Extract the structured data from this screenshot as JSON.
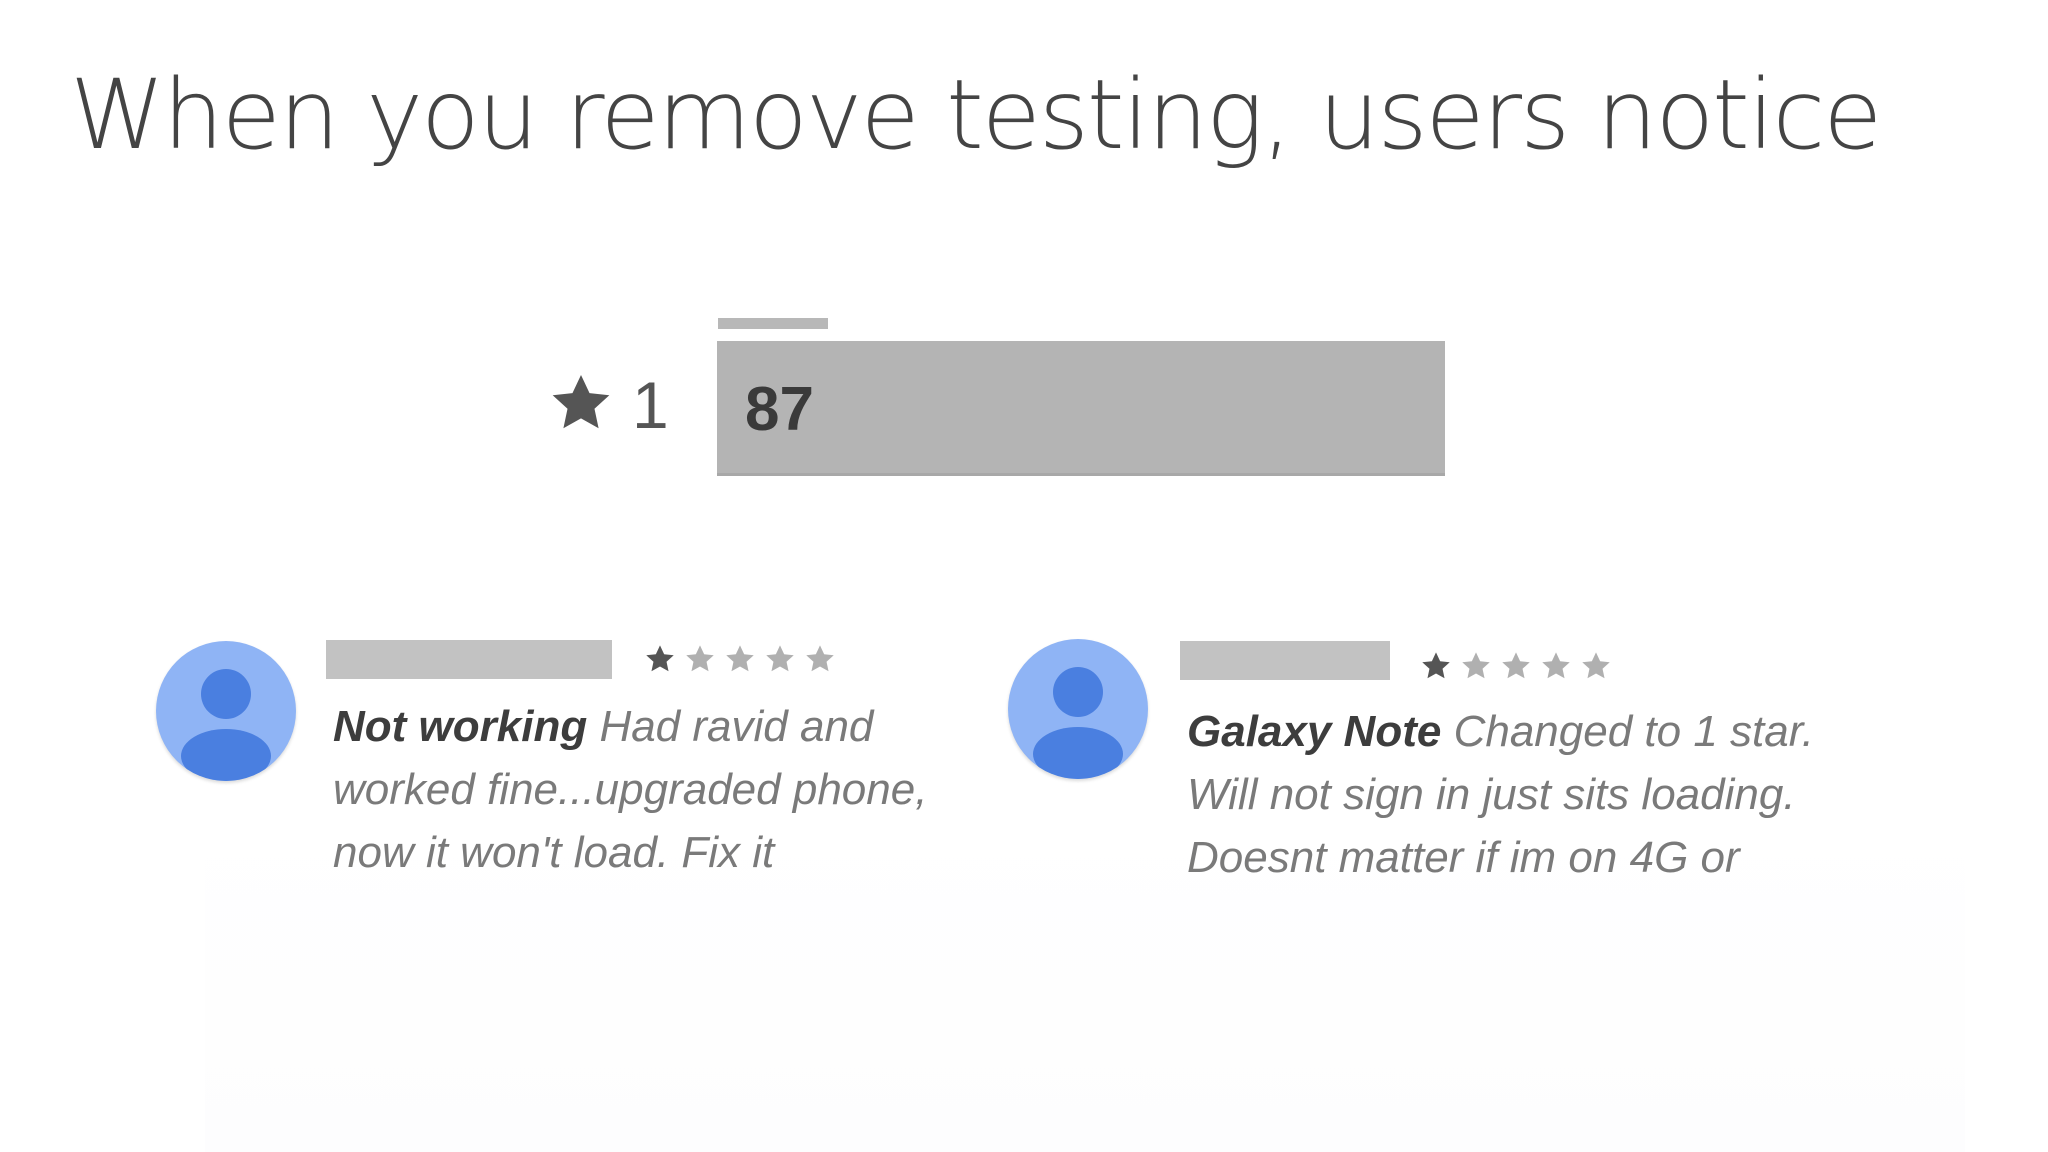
{
  "slide": {
    "title": "When you remove testing, users notice"
  },
  "rating": {
    "star_icon": "star-icon",
    "stars": "1",
    "count": "87",
    "fill_fraction": 1.0
  },
  "reviews": [
    {
      "avatar_icon": "person-icon",
      "star_rating": 1,
      "star_max": 5,
      "title": "Not working",
      "lines": [
        "Had ravid and",
        "worked fine...upgraded phone,",
        "now it won't load. Fix it"
      ]
    },
    {
      "avatar_icon": "person-icon",
      "star_rating": 1,
      "star_max": 5,
      "title": "Galaxy Note",
      "lines": [
        "Changed to 1 star.",
        "Will not sign in just sits loading.",
        "Doesnt matter if im on 4G or"
      ]
    }
  ],
  "colors": {
    "title_text": "#444444",
    "bar": "#b4b4b4",
    "avatar_bg": "#8fb4f5",
    "avatar_figure": "#4a7fe0",
    "star_filled": "#555555",
    "star_empty": "#b0b0b0"
  }
}
